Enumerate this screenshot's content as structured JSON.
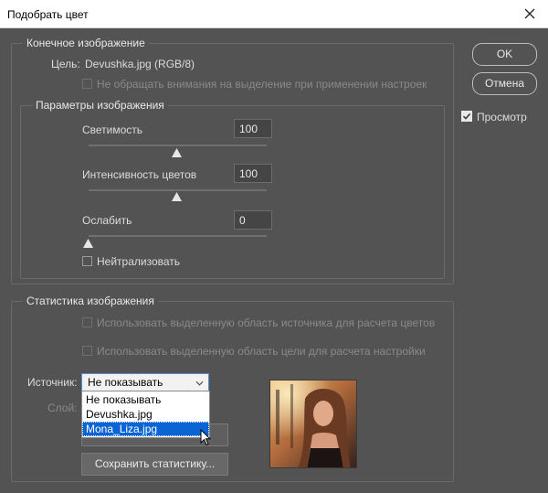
{
  "window": {
    "title": "Подобрать цвет"
  },
  "buttons": {
    "ok": "OK",
    "cancel": "Отмена"
  },
  "preview": {
    "label": "Просмотр",
    "checked": true
  },
  "destination": {
    "legend": "Конечное изображение",
    "target_label": "Цель:",
    "target_value": "Devushka.jpg (RGB/8)",
    "ignore_selection": "Не обращать внимания на выделение при применении настроек"
  },
  "image_options": {
    "legend": "Параметры изображения",
    "luminance_label": "Светимость",
    "luminance_value": "100",
    "color_intensity_label": "Интенсивность цветов",
    "color_intensity_value": "100",
    "fade_label": "Ослабить",
    "fade_value": "0",
    "neutralize_label": "Нейтрализовать"
  },
  "statistics": {
    "legend": "Статистика изображения",
    "use_source_selection": "Использовать выделенную область источника для расчета цветов",
    "use_target_selection": "Использовать выделенную область цели для расчета настройки",
    "source_label": "Источник:",
    "source_value": "Не показывать",
    "layer_label": "Слой:",
    "source_options": [
      "Не показывать",
      "Devushka.jpg",
      "Mona_Liza.jpg"
    ],
    "save_stats": "Сохранить статистику..."
  }
}
